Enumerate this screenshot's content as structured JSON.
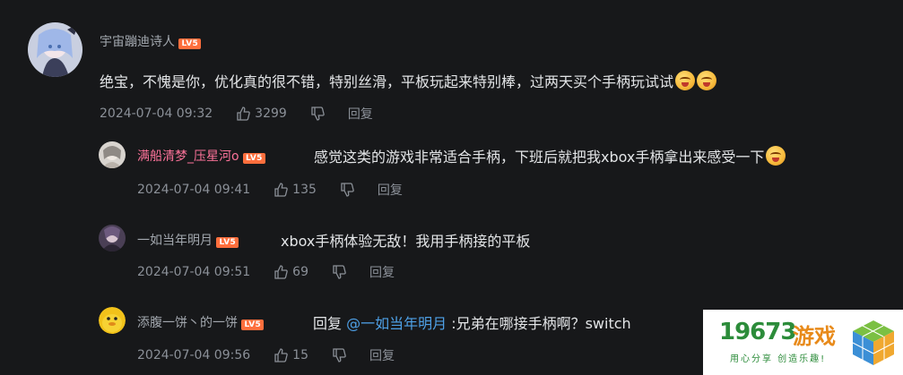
{
  "comments": [
    {
      "username": "宇宙蹦迪诗人",
      "level": "LV5",
      "content": "绝宝，不愧是你，优化真的很不错，特别丝滑，平板玩起来特别棒，过两天买个手柄玩试试",
      "time": "2024-07-04 09:32",
      "likes": "3299",
      "reply_label": "回复",
      "avatar_icon": "anime-avatar"
    }
  ],
  "replies": [
    {
      "username": "满船清梦_压星河o",
      "level": "LV5",
      "content": "感觉这类的游戏非常适合手柄，下班后就把我xbox手柄拿出来感受一下",
      "time": "2024-07-04 09:41",
      "likes": "135",
      "reply_label": "回复"
    },
    {
      "username": "一如当年明月",
      "level": "LV5",
      "content": "xbox手柄体验无敌！我用手柄接的平板",
      "time": "2024-07-04 09:51",
      "likes": "69",
      "reply_label": "回复"
    },
    {
      "username": "添腹一饼丶的一饼",
      "level": "LV5",
      "content_prefix": "回复 ",
      "mention": "@一如当年明月",
      "content": " :兄弟在哪接手柄啊？switch",
      "time": "2024-07-04 09:56",
      "likes": "15",
      "reply_label": "回复"
    }
  ],
  "watermark": {
    "number": "19673",
    "name": "游戏",
    "slogan": "用心分享 创造乐趣!"
  },
  "colors": {
    "background": "#17181a",
    "vip_name": "#fb7299",
    "mention": "#4ea0e6",
    "level_badge": "#ff6f3d"
  }
}
